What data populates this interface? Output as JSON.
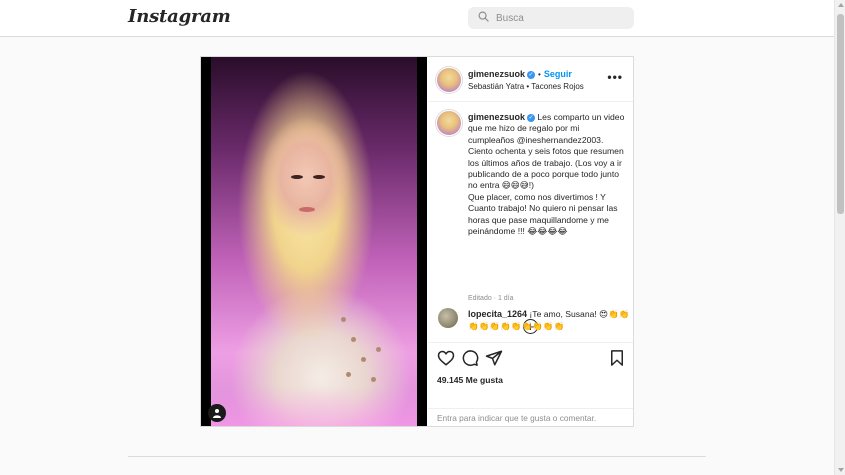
{
  "app": {
    "logo": "Instagram"
  },
  "search": {
    "placeholder": "Busca"
  },
  "post": {
    "author": "gimenezsuok",
    "follow_label": "Seguir",
    "dot": "•",
    "audio": "Sebastián Yatra • Tacones Rojos",
    "more": "•••",
    "caption": "Les comparto un video que me hizo de regalo por mi cumpleaños @ineshernandez2003. Ciento ochenta y seis fotos que resumen los últimos años de trabajo. (Los voy a ir publicando de a poco porque todo junto no entra 😄😄😅!)\nQue placer, como nos divertimos ! Y Cuanto trabajo! No quiero ni pensar las horas que pase maquillandome y me peinándome !!! 😂😂😂😂",
    "edited": "Editado · 1 día",
    "load_more": "+",
    "comment": {
      "user": "lopecita_1264",
      "text": " ¡Te amo, Susana! 😍👏👏👏👏👏👏👏👏👏👏👏"
    },
    "likes": "49.145 Me gusta",
    "add_comment_enter": "Entra",
    "add_comment_rest": " para indicar que te gusta o comentar."
  },
  "icons": {
    "search": "search-icon",
    "like": "heart-icon",
    "comment": "comment-icon",
    "share": "send-icon",
    "save": "bookmark-icon",
    "tag": "user-tag-icon",
    "verified": "verified-badge-icon"
  },
  "colors": {
    "accent": "#0095f6",
    "verified": "#3897f0",
    "border": "#dbdbdb",
    "bg": "#fafafa"
  }
}
